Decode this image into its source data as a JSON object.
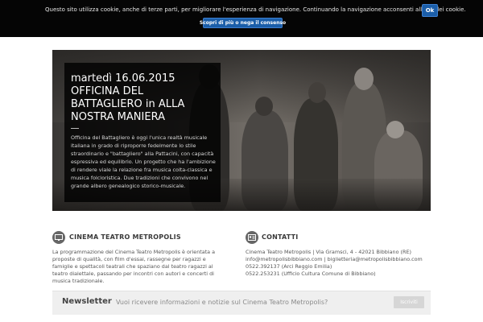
{
  "cookie_bar": {
    "text": "Questo sito utilizza cookie, anche di terze parti, per migliorare l'esperienza di navigazione. Continuando la navigazione acconsenti all'uso dei cookie.",
    "ok_label": "Ok",
    "more_label": "Scopri di più o nega il consenso"
  },
  "hero": {
    "title": "martedì 16.06.2015 OFFICINA DEL BATTAGLIERO in ALLA NOSTRA MANIERA",
    "body": "Officina del Battagliero è oggi l'unica realtà musicale italiana in grado di riproporre fedelmente lo stile straordinario e \"battagliero\" alla Pattacini, con capacità espressiva ed equilibrio. Un progetto che ha l'ambizione di rendere viale la relazione fra musica colta-classica e musica folcloristica. Due tradizioni che convivono nel grande albero genealogico storico-musicale."
  },
  "cinema": {
    "title": "CINEMA TEATRO METROPOLIS",
    "text": "La programmazione del Cinema Teatro Metropolis è orientata a proposte di qualità, con film d'essai, rassegne per ragazzi e famiglie e spettacoli teatrali che spaziano dal teatro ragazzi al teatro dialettale, passando per incontri con autori e concerti di musica tradizionale."
  },
  "contatti": {
    "title": "CONTATTI",
    "lines": [
      "Cinema Teatro Metropolis | Via Gramsci, 4 - 42021 Bibbiano (RE)",
      "info@metropolisbibbiano.com | biglietteria@metropolisbibbiano.com",
      "0522.392137 (Arci Reggio Emilia)",
      "0522.253231 (Ufficio Cultura Comune di Bibbiano)"
    ]
  },
  "newsletter": {
    "title": "Newsletter",
    "text": "Vuoi ricevere informazioni e notizie sul Cinema Teatro Metropolis?",
    "button_label": "Iscriviti"
  },
  "icons": {
    "cinema": "screen-icon",
    "contatti": "contact-card-icon"
  },
  "colors": {
    "cookie_button": "#1b5ea9",
    "cookie_bar": "#050505",
    "caption_bg": "#000000"
  }
}
